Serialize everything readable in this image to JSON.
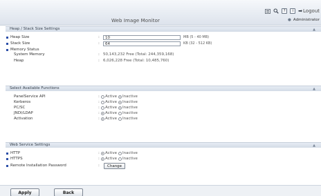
{
  "header": {
    "brand": "Web Image Monitor",
    "logout_label": "Logout",
    "user": "Administrator",
    "icons": [
      "home-icon",
      "search-icon",
      "help-icon",
      "info-icon",
      "logout-icon",
      "person-icon"
    ],
    "question_glyph": "?",
    "info_glyph": "i"
  },
  "heap": {
    "title": "Heap / Stack Size Settings",
    "heap_size_label": "Heap Size",
    "heap_size_value": "10",
    "heap_size_unit": "MB (5 - 40 MB)",
    "stack_size_label": "Stack Size",
    "stack_size_value": "64",
    "stack_size_unit": "KB (32 - 512 KB)",
    "memory_status_label": "Memory Status",
    "system_memory_label": "System Memory",
    "system_memory_value": "50,143,232 Free   (Total: 244,359,168)",
    "heap_label": "Heap",
    "heap_value": "6,026,228 Free   (Total: 10,485,760)"
  },
  "functions": {
    "title": "Select Available Functions",
    "active_label": "Active",
    "inactive_label": "Inactive",
    "items": [
      {
        "label": "PanelService API",
        "selected": "Inactive"
      },
      {
        "label": "Kerberos",
        "selected": "Inactive"
      },
      {
        "label": "PC/SC",
        "selected": "Inactive"
      },
      {
        "label": "JNDI/LDAP",
        "selected": "Active"
      },
      {
        "label": "Activation",
        "selected": "Active"
      }
    ]
  },
  "web": {
    "title": "Web Service Settings",
    "active_label": "Active",
    "inactive_label": "Inactive",
    "http_label": "HTTP",
    "http_selected": "Active",
    "https_label": "HTTPS",
    "https_selected": "Active",
    "remote_label": "Remote Installation Password",
    "change_label": "Change"
  },
  "footer": {
    "apply_label": "Apply",
    "back_label": "Back"
  },
  "colors": {
    "section_header": "#d3dbe6",
    "bullet": "#2b4ea8",
    "accent_text": "#36404c"
  }
}
